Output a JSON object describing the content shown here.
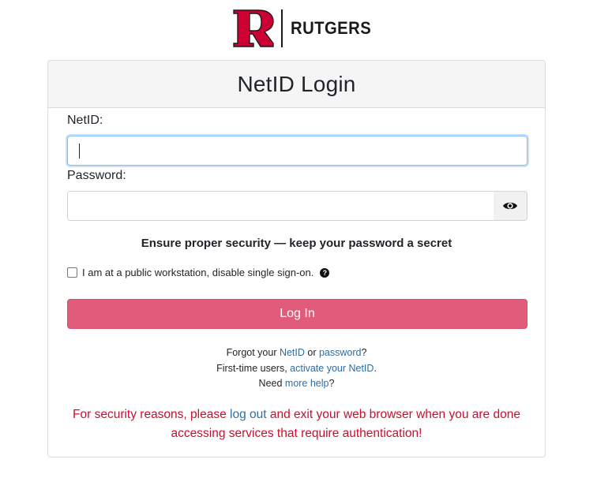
{
  "logo": {
    "wordmark": "RUTGERS",
    "icon": "rutgers-r-logo",
    "brand_color": "#cc0033"
  },
  "card": {
    "title": "NetID Login"
  },
  "form": {
    "netid_label": "NetID:",
    "netid_value": "",
    "password_label": "Password:",
    "password_value": "",
    "show_password_icon": "eye-icon",
    "security_note": "Ensure proper security — keep your password a secret",
    "public_workstation_label": "I am at a public workstation, disable single sign-on.",
    "public_workstation_checked": false,
    "help_icon": "question-circle-icon",
    "login_label": "Log In",
    "login_color": "#e05c7a"
  },
  "help": {
    "forgot_prefix": "Forgot your ",
    "netid_link": "NetID",
    "or": " or ",
    "password_link": "password",
    "forgot_suffix": "?",
    "first_time_prefix": "First-time users, ",
    "activate_link": "activate your NetID",
    "first_time_suffix": ".",
    "need_prefix": "Need ",
    "more_help_link": "more help",
    "need_suffix": "?",
    "link_color": "#2e6da4"
  },
  "warning": {
    "prefix": "For security reasons, please ",
    "logout_link": "log out",
    "suffix": " and exit your web browser when you are done accessing services that require authentication!",
    "color": "#c8102e"
  }
}
